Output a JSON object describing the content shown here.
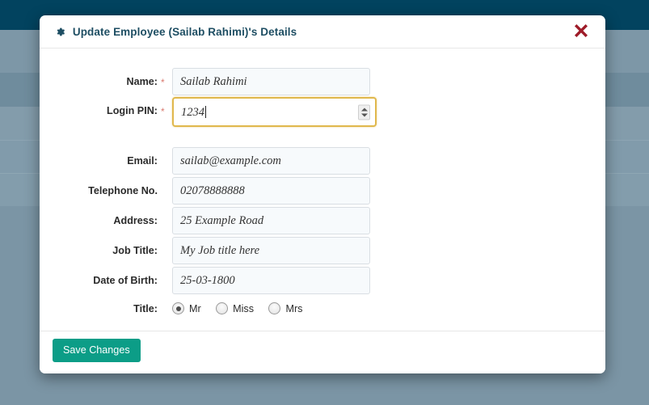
{
  "background": {
    "navbar_color": "#02435f",
    "overlay_color": "#7b95a5"
  },
  "modal": {
    "title": "Update Employee (Sailab Rahimi)'s Details",
    "gear_icon": "gear-icon",
    "close_icon": "close-icon",
    "close_color": "#9e1b28"
  },
  "form": {
    "required_marker": "*",
    "fields": [
      {
        "label": "Name:",
        "value": "Sailab Rahimi",
        "required": true,
        "type": "text"
      },
      {
        "label": "Login PIN:",
        "value": "1234",
        "required": true,
        "type": "number",
        "focused": true
      },
      {
        "label": "Email:",
        "value": "sailab@example.com",
        "required": false,
        "type": "email"
      },
      {
        "label": "Telephone No.",
        "value": "02078888888",
        "required": false,
        "type": "tel"
      },
      {
        "label": "Address:",
        "value": "25 Example Road",
        "required": false,
        "type": "text"
      },
      {
        "label": "Job Title:",
        "value": "My Job title here",
        "required": false,
        "type": "text"
      },
      {
        "label": "Date of Birth:",
        "value": "25-03-1800",
        "required": false,
        "type": "text"
      }
    ],
    "title_row": {
      "label": "Title:",
      "options": [
        {
          "label": "Mr",
          "checked": true
        },
        {
          "label": "Miss",
          "checked": false
        },
        {
          "label": "Mrs",
          "checked": false
        }
      ]
    }
  },
  "footer": {
    "save_label": "Save Changes",
    "save_color": "#0c9d87"
  }
}
